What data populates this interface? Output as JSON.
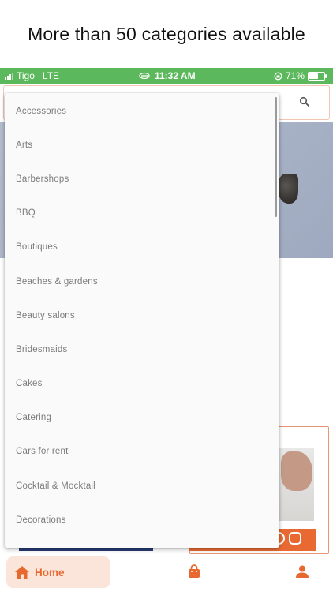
{
  "caption": "More than 50 categories available",
  "status_bar": {
    "carrier": "Tigo",
    "network": "LTE",
    "time": "11:32 AM",
    "battery": "71%",
    "battery_level": 0.71,
    "bg_color": "#5cb85c"
  },
  "search": {
    "icon": "search-icon"
  },
  "dropdown": {
    "items": [
      "Accessories",
      "Arts",
      "Barbershops",
      "BBQ",
      "Boutiques",
      "Beaches & gardens",
      "Beauty salons",
      "Bridesmaids",
      "Cakes",
      "Catering",
      "Cars for rent",
      "Cocktail & Mocktail",
      "Decorations"
    ]
  },
  "bottom_nav": {
    "home_label": "Home",
    "accent_color": "#e8692f",
    "icons": [
      "home-icon",
      "shopping-bag-icon",
      "person-icon"
    ]
  }
}
